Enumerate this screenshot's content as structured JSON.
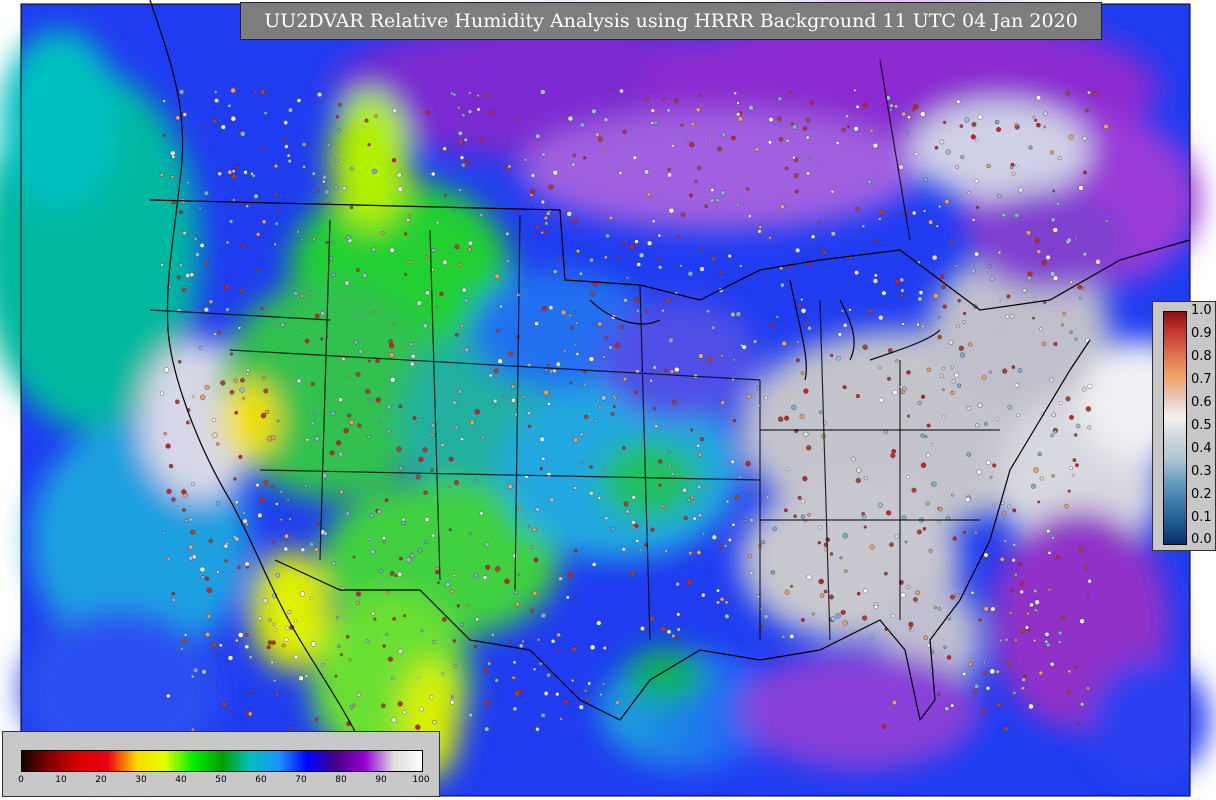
{
  "title": "UU2DVAR Relative Humidity Analysis using HRRR Background 11 UTC 04 Jan 2020",
  "variable_scale": {
    "ticks": [
      "0",
      "10",
      "20",
      "30",
      "40",
      "50",
      "60",
      "70",
      "80",
      "90",
      "100"
    ],
    "min": 0,
    "max": 100,
    "colors": [
      "#140000",
      "#8a0000",
      "#d90000",
      "#e80010",
      "#ffd700",
      "#dfff00",
      "#00ee00",
      "#00a000",
      "#00bfbf",
      "#1e90ff",
      "#0000ff",
      "#4b0082",
      "#9400d3",
      "#dcdcdc",
      "#ffffff"
    ]
  },
  "observation_scale": {
    "ticks": [
      "1.0",
      "0.9",
      "0.8",
      "0.7",
      "0.6",
      "0.5",
      "0.4",
      "0.3",
      "0.2",
      "0.1",
      "0.0"
    ],
    "min": 0.0,
    "max": 1.0,
    "colors": [
      "#08306b",
      "#1f5a8f",
      "#3d7ca8",
      "#6a9fbf",
      "#aec6d4",
      "#d0d6db",
      "#f2f2f2",
      "#e6c6b3",
      "#f0a065",
      "#e07050",
      "#c83a30",
      "#8c1010"
    ]
  }
}
